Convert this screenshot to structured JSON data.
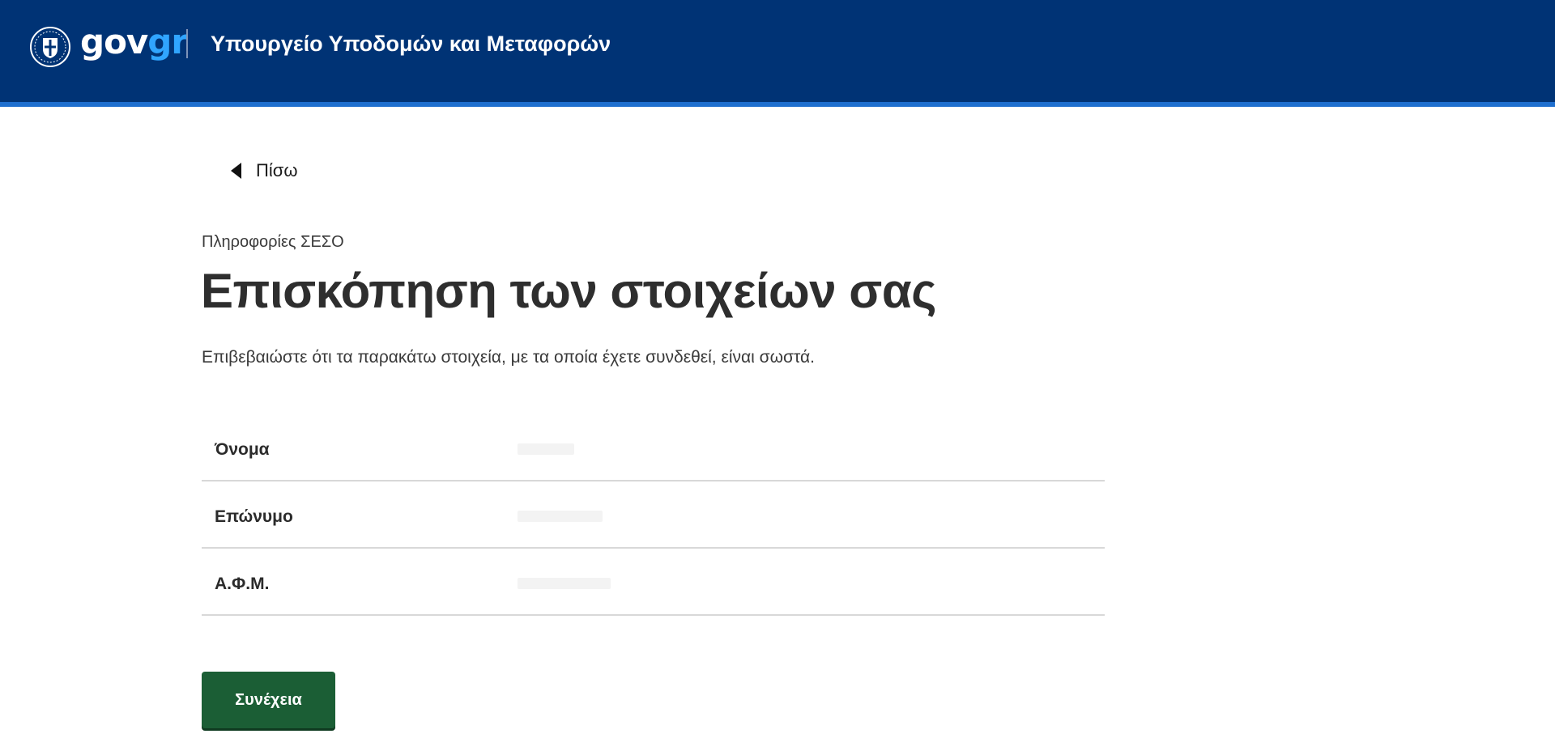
{
  "header": {
    "brand_gov": "gov",
    "brand_gr": "gr",
    "ministry": "Υπουργείο Υποδομών και Μεταφορών",
    "emblem_icon": "greek-coat-of-arms-icon",
    "colors": {
      "header_bg": "#003375",
      "header_border": "#1e6fcf",
      "brand_accent": "#30a5ff"
    }
  },
  "nav": {
    "back_label": "Πίσω",
    "back_icon": "caret-left-icon"
  },
  "main": {
    "caption": "Πληροφορίες ΣΕΣΟ",
    "title": "Επισκόπηση των στοιχείων σας",
    "intro": "Επιβεβαιώστε ότι τα παρακάτω στοιχεία, με τα οποία έχετε συνδεθεί, είναι σωστά.",
    "rows": [
      {
        "key": "Όνομα",
        "value": ""
      },
      {
        "key": "Επώνυμο",
        "value": ""
      },
      {
        "key": "Α.Φ.Μ.",
        "value": ""
      }
    ],
    "continue_label": "Συνέχεια",
    "colors": {
      "button_bg": "#1b5e35"
    }
  }
}
